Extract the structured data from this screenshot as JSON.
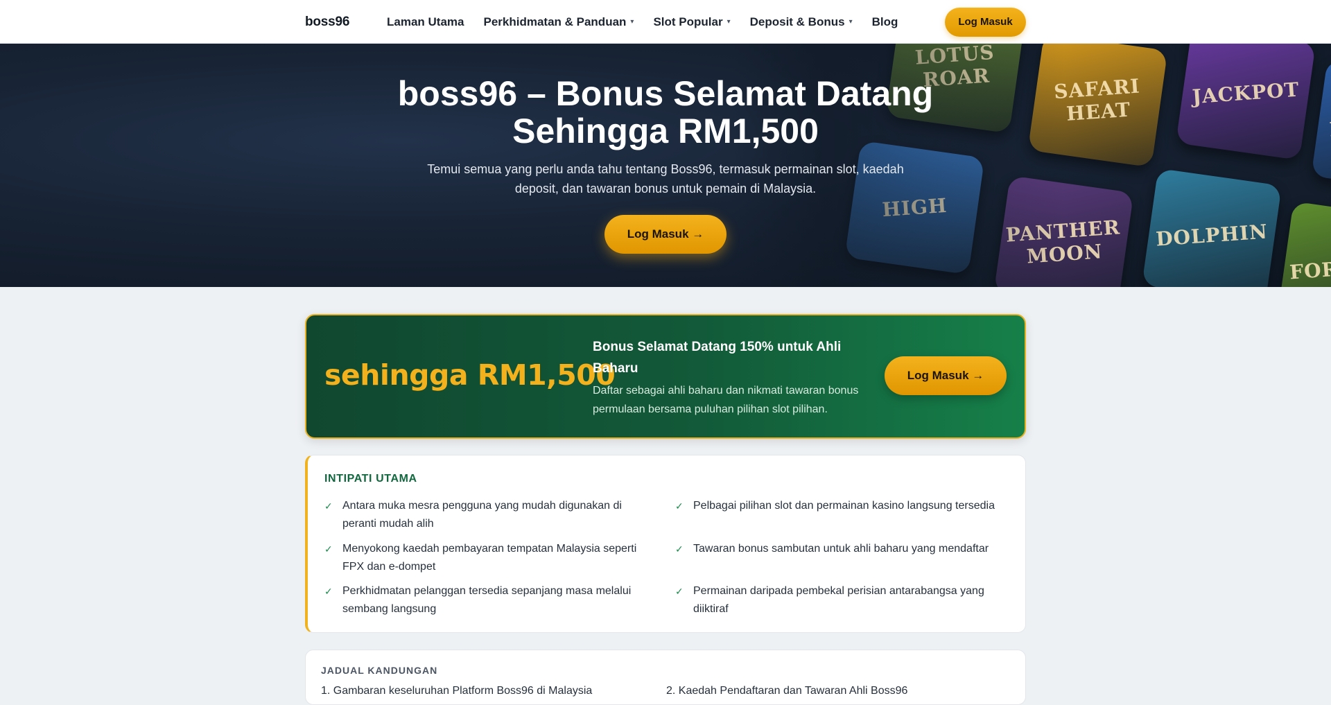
{
  "nav": {
    "logo": "boss96",
    "links": [
      {
        "label": "Laman Utama",
        "dropdown": false
      },
      {
        "label": "Perkhidmatan & Panduan",
        "dropdown": true
      },
      {
        "label": "Slot Popular",
        "dropdown": true
      },
      {
        "label": "Deposit & Bonus",
        "dropdown": true
      },
      {
        "label": "Blog",
        "dropdown": false
      }
    ],
    "caret": "▾",
    "login_label": "Log Masuk"
  },
  "hero": {
    "title": "boss96 – Bonus Selamat Datang Sehingga RM1,500",
    "subtitle": "Temui semua yang perlu anda tahu tentang Boss96, termasuk permainan slot, kaedah deposit, dan tawaran bonus untuk pemain di Malaysia.",
    "cta_label": "Log Masuk →",
    "tiles": [
      {
        "label": "LOTUS ROAR",
        "color": "#6b8f3a"
      },
      {
        "label": "SAFARI HEAT",
        "color": "#d79a1c"
      },
      {
        "label": "JACKPOT",
        "color": "#6a3aa2"
      },
      {
        "label": "DRAGON",
        "color": "#2c5ea8"
      },
      {
        "label": "HIGH",
        "color": "#3b7fd0"
      },
      {
        "label": "PANTHER MOON",
        "color": "#5a3a7c"
      },
      {
        "label": "DOLPHIN",
        "color": "#2f7d9e"
      },
      {
        "label": "FORTUNE",
        "color": "#5f8f2e"
      }
    ]
  },
  "promo": {
    "amount": "sehingga RM1,500",
    "title": "Bonus Selamat Datang 150% untuk Ahli Baharu",
    "description": "Daftar sebagai ahli baharu dan nikmati tawaran bonus permulaan bersama puluhan pilihan slot pilihan.",
    "cta_label": "Log Masuk →"
  },
  "key_points": {
    "title": "INTIPATI UTAMA",
    "check": "✓",
    "items": [
      "Antara muka mesra pengguna yang mudah digunakan di peranti mudah alih",
      "Pelbagai pilihan slot dan permainan kasino langsung tersedia",
      "Menyokong kaedah pembayaran tempatan Malaysia seperti FPX dan e-dompet",
      "Tawaran bonus sambutan untuk ahli baharu yang mendaftar",
      "Perkhidmatan pelanggan tersedia sepanjang masa melalui sembang langsung",
      "Permainan daripada pembekal perisian antarabangsa yang diiktiraf"
    ]
  },
  "toc": {
    "title": "JADUAL KANDUNGAN",
    "items": [
      "1. Gambaran keseluruhan Platform Boss96 di Malaysia",
      "2. Kaedah Pendaftaran dan Tawaran Ahli Boss96"
    ]
  },
  "colors": {
    "accent": "#f0b31f",
    "promo_green": "#125a39",
    "key_title": "#12683e"
  }
}
